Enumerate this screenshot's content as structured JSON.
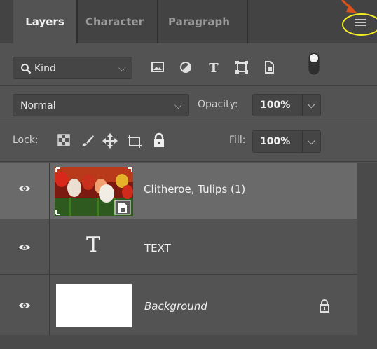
{
  "tabs": [
    {
      "label": "Layers",
      "active": true
    },
    {
      "label": "Character",
      "active": false
    },
    {
      "label": "Paragraph",
      "active": false
    }
  ],
  "panel_menu": {
    "icon": "hamburger-menu-icon"
  },
  "filter": {
    "kind_label": "Kind",
    "icons": [
      "image-filter-icon",
      "adjustment-filter-icon",
      "type-filter-icon",
      "shape-filter-icon",
      "smart-object-filter-icon",
      "filter-toggle-icon"
    ]
  },
  "blend": {
    "mode": "Normal",
    "opacity_label": "Opacity:",
    "opacity_value": "100%"
  },
  "lock": {
    "label": "Lock:",
    "icons": [
      "lock-transparent-pixels-icon",
      "lock-image-pixels-icon",
      "lock-position-icon",
      "lock-artboard-icon",
      "lock-all-icon"
    ],
    "fill_label": "Fill:",
    "fill_value": "100%"
  },
  "layers": [
    {
      "name": "Clitheroe, Tulips (1)",
      "type": "smart-object",
      "visible": true,
      "selected": true
    },
    {
      "name": "TEXT",
      "type": "text",
      "visible": true,
      "selected": false
    },
    {
      "name": "Background",
      "type": "background",
      "visible": true,
      "selected": false,
      "locked": true
    }
  ],
  "colors": {
    "panel_bg": "#535353",
    "tabbar_bg": "#434343",
    "selected_layer": "#6a6a6a",
    "annotation_circle": "#f4ed21",
    "annotation_arrow": "#d8521d"
  }
}
